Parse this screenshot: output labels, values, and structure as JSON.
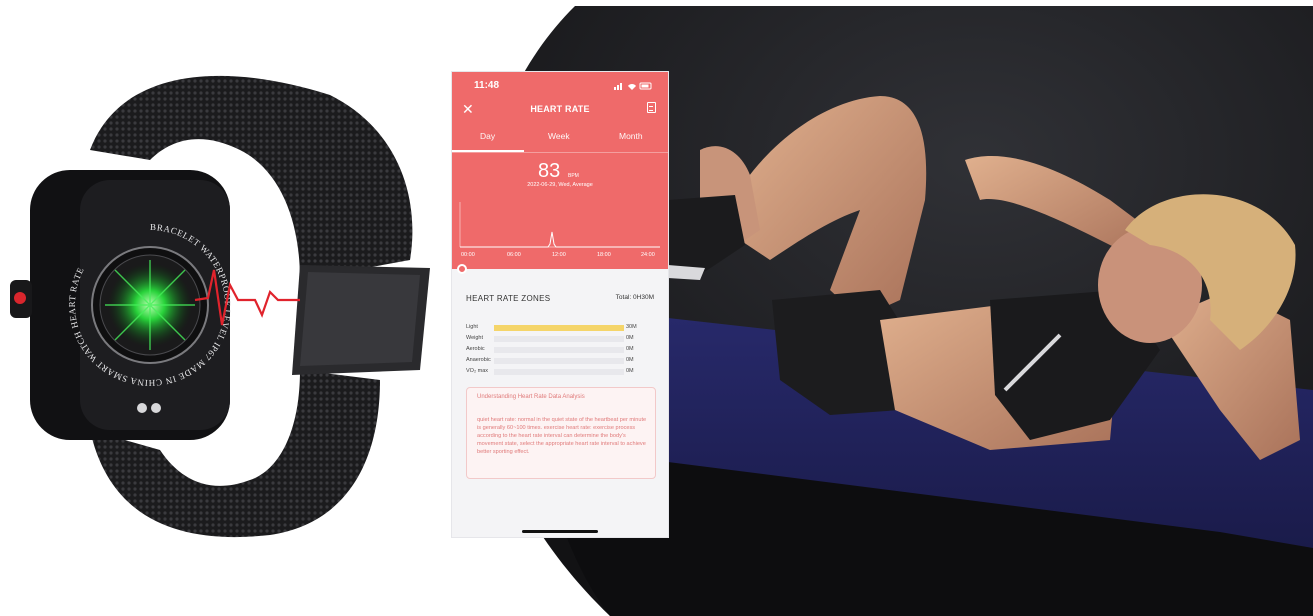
{
  "watch": {
    "ring_text": "BRACELET WATERPROOF LEVEL IP67 MADE IN CHINA SMART WATCH HEART RATE"
  },
  "phone": {
    "time": "11:48",
    "title": "HEART RATE",
    "tabs": [
      "Day",
      "Week",
      "Month"
    ],
    "active_tab": "Day",
    "value": "83",
    "unit": "BPM",
    "date_line": "2022-06-29, Wed, Average",
    "x_ticks": [
      "00:00",
      "06:00",
      "12:00",
      "18:00",
      "24:00"
    ],
    "zones": {
      "title": "HEART RATE ZONES",
      "total_label": "Total:",
      "total_value": "0H30M",
      "rows": [
        {
          "label": "Light",
          "value": "30M",
          "fraction": 1.0
        },
        {
          "label": "Weight",
          "value": "0M",
          "fraction": 0
        },
        {
          "label": "Aerobic",
          "value": "0M",
          "fraction": 0
        },
        {
          "label": "Anaerobic",
          "value": "0M",
          "fraction": 0
        },
        {
          "label": "VO₂ max",
          "value": "0M",
          "fraction": 0
        }
      ]
    },
    "info": {
      "title": "Understanding Heart Rate Data Analysis",
      "body": "quiet heart rate: normal in the quiet state of the heartbeat per minute is generally 60~100 times. exercise heart rate: exercise process according to the heart rate interval can determine the body's movement state, select the appropriate heart rate interval to achieve better sporting effect."
    },
    "colors": {
      "header": "#ef6a6a",
      "zone_fill": "#f5d56a",
      "accent_text": "#e07a7a"
    }
  }
}
